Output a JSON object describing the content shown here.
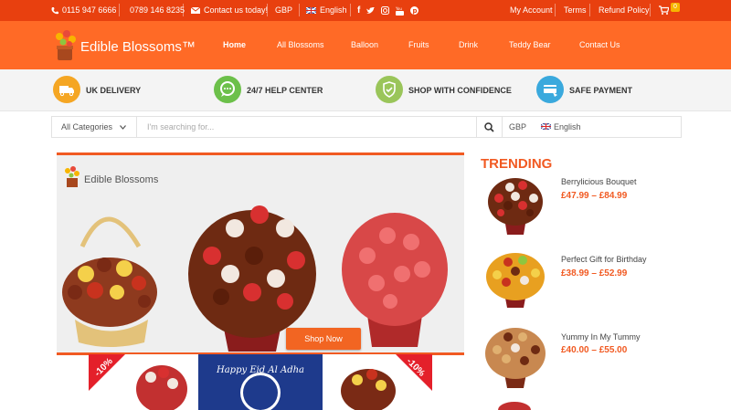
{
  "topbar": {
    "phone1": "0115 947 6666",
    "phone2": "0789 146 8235",
    "contact": "Contact us today!",
    "currency": "GBP",
    "language": "English",
    "social_icons": [
      "facebook-icon",
      "twitter-icon",
      "instagram-icon",
      "youtube-icon",
      "pinterest-icon"
    ],
    "my_account": "My Account",
    "terms": "Terms",
    "refund": "Refund Policy",
    "cart_count": "0"
  },
  "brand": {
    "name": "Edible Blossoms™"
  },
  "nav": {
    "home": "Home",
    "all_blossoms": "All Blossoms",
    "balloon": "Balloon",
    "fruits": "Fruits",
    "drink": "Drink",
    "teddy_bear": "Teddy Bear",
    "contact_us": "Contact Us"
  },
  "features": [
    {
      "label": "UK DELIVERY",
      "icon": "truck-icon",
      "color": "#f5a623"
    },
    {
      "label": "24/7 HELP CENTER",
      "icon": "chat-icon",
      "color": "#6cc04a"
    },
    {
      "label": "SHOP WITH CONFIDENCE",
      "icon": "shield-icon",
      "color": "#9ac55a"
    },
    {
      "label": "SAFE PAYMENT",
      "icon": "payment-icon",
      "color": "#3aa9dd"
    }
  ],
  "search": {
    "category": "All Categories",
    "placeholder": "I'm searching for...",
    "currency": "GBP",
    "language": "English"
  },
  "slider": {
    "logo_text": "Edible Blossoms",
    "button": "Shop Now"
  },
  "banner": {
    "badge_left": "-10%",
    "badge_right": "-10%",
    "greeting": "Happy Eid Al Adha"
  },
  "trending": {
    "title": "TRENDING",
    "products": [
      {
        "name": "Berrylicious Bouquet",
        "price": "£47.99 – £84.99"
      },
      {
        "name": "Perfect Gift for Birthday",
        "price": "£38.99 – £52.99"
      },
      {
        "name": "Yummy In My Tummy",
        "price": "£40.00 – £55.00"
      }
    ]
  },
  "colors": {
    "topbar": "#e8400f",
    "navbar": "#ff6a26",
    "accent": "#f15a22"
  }
}
